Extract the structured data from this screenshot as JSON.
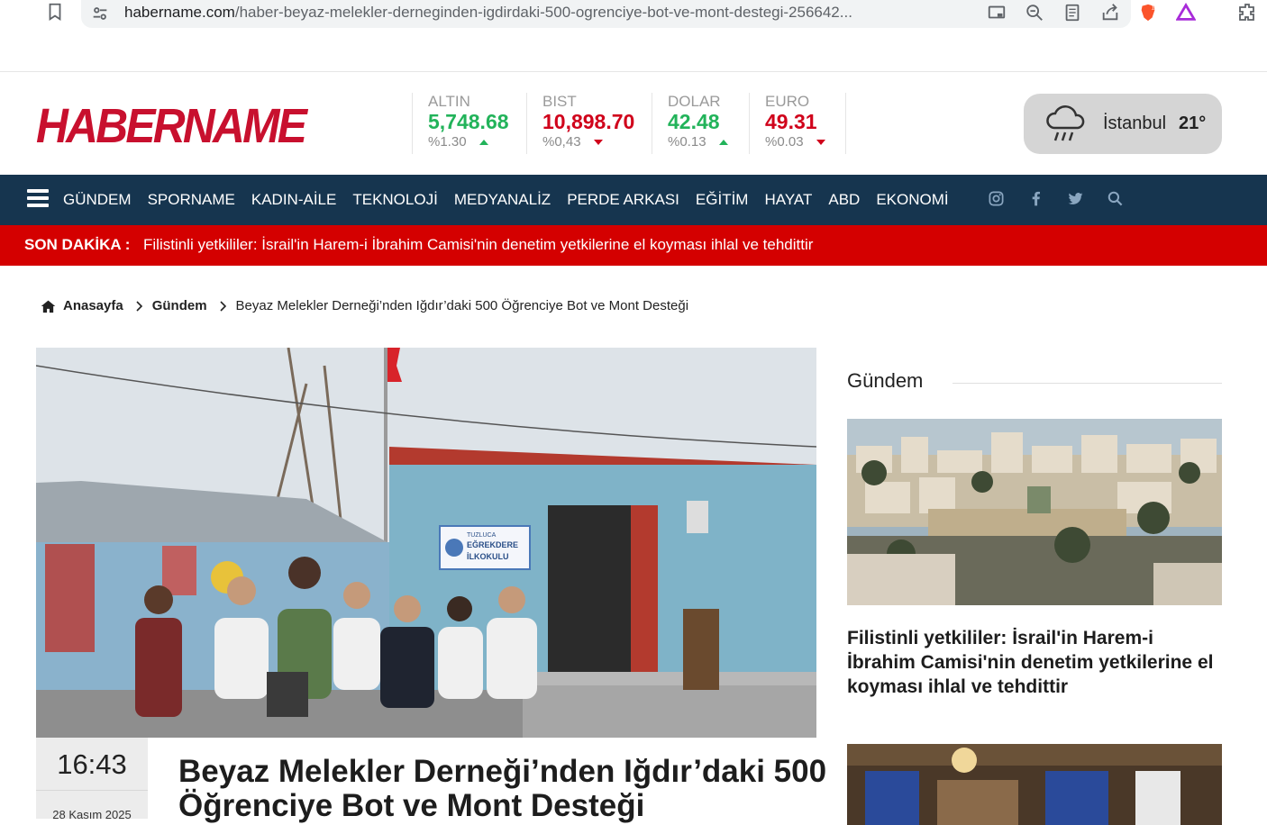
{
  "browser": {
    "url_host": "habername.com",
    "url_path": "/haber-beyaz-melekler-derneginden-igdirdaki-500-ogrenciye-bot-ve-mont-destegi-256642...",
    "ext_badge": "1"
  },
  "header": {
    "logo": "HABERNAME",
    "markets": [
      {
        "name": "ALTIN",
        "value": "5,748.68",
        "change": "%1.30",
        "trend": "up"
      },
      {
        "name": "BIST",
        "value": "10,898.70",
        "change": "%0,43",
        "trend": "down"
      },
      {
        "name": "DOLAR",
        "value": "42.48",
        "change": "%0.13",
        "trend": "up"
      },
      {
        "name": "EURO",
        "value": "49.31",
        "change": "%0.03",
        "trend": "down"
      }
    ],
    "weather": {
      "city": "İstanbul",
      "temp": "21°",
      "icon": "rain-cloud-icon"
    }
  },
  "nav": {
    "items": [
      "GÜNDEM",
      "SPORNAME",
      "KADIN-AİLE",
      "TEKNOLOJİ",
      "MEDYANALİZ",
      "PERDE ARKASI",
      "EĞİTİM",
      "HAYAT",
      "ABD",
      "EKONOMİ"
    ],
    "social": [
      "instagram-icon",
      "facebook-icon",
      "twitter-icon",
      "search-icon"
    ]
  },
  "breaking": {
    "label": "SON DAKİKA :",
    "text": "Filistinli yetkililer: İsrail'in Harem-i İbrahim Camisi'nin denetim yetkilerine el koyması ihlal ve tehdittir"
  },
  "breadcrumb": {
    "home": "Anasayfa",
    "category": "Gündem",
    "current": "Beyaz Melekler Derneği’nden Iğdır’daki 500 Öğrenciye Bot ve Mont Desteği"
  },
  "article": {
    "time": "16:43",
    "date": "28 Kasım 2025",
    "title": "Beyaz Melekler Derneği’nden Iğdır’daki 500 Öğrenciye Bot ve Mont Desteği",
    "sign_line1": "TUZLUCA",
    "sign_line2": "EĞREKDERE",
    "sign_line3": "İLKOKULU"
  },
  "sidebar": {
    "title": "Gündem",
    "items": [
      {
        "title": "Filistinli yetkililer: İsrail'in Harem-i İbrahim Camisi'nin denetim yetkilerine el koyması ihlal ve tehdittir"
      }
    ]
  },
  "colors": {
    "brand_red": "#c8102e",
    "nav_bg": "#16354f",
    "breaking_bg": "#d40000",
    "up": "#22b35a",
    "down": "#d0021b"
  }
}
